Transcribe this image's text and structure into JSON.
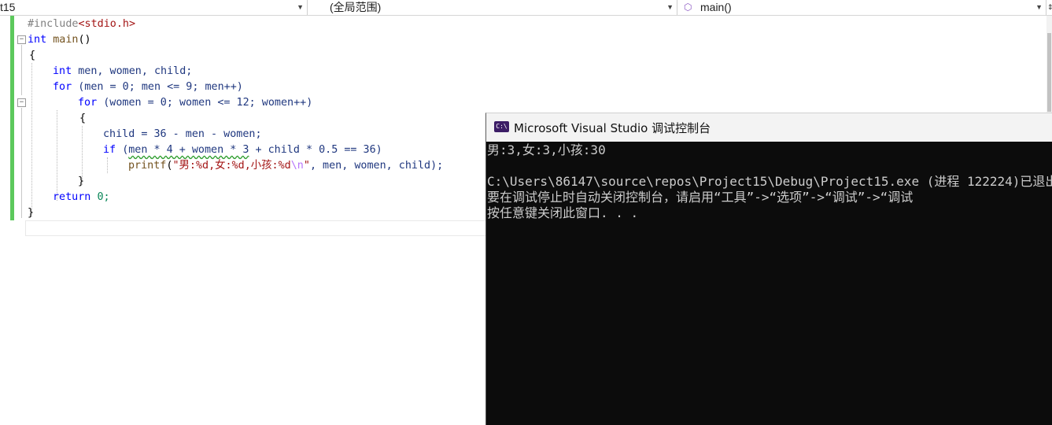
{
  "navbar": {
    "project_combo": "t15",
    "scope_combo": "(全局范围)",
    "function_combo": "main()"
  },
  "editor": {
    "lines": [
      {
        "kind": "include",
        "directive": "#include",
        "header": "<stdio.h>"
      },
      {
        "kind": "text",
        "kw": "int",
        "rest_fn": "main",
        "rest": "()"
      },
      {
        "kind": "text",
        "text": "{"
      },
      {
        "kind": "decl",
        "kw": "int",
        "text": "men, women, child;"
      },
      {
        "kind": "for1",
        "kw": "for",
        "text": "(men = 0; men <= 9; men++)"
      },
      {
        "kind": "for2",
        "kw": "for",
        "text": "(women = 0; women <= 12; women++)"
      },
      {
        "kind": "text",
        "text": "{"
      },
      {
        "kind": "assign",
        "text": "child = 36 - men - women;"
      },
      {
        "kind": "if",
        "kw": "if",
        "squiggle": "men * 4 + women * 3",
        "text_pre": "(",
        "text_post": " + child * 0.5 == 36)"
      },
      {
        "kind": "printf",
        "fn": "printf",
        "str": "\"男:%d,女:%d,小孩:%d",
        "esc": "\\n",
        "str_end": "\"",
        "args": ", men, women, child);"
      },
      {
        "kind": "text",
        "text": "}"
      },
      {
        "kind": "return",
        "kw": "return",
        "text": "0;"
      },
      {
        "kind": "text",
        "text": "}"
      }
    ]
  },
  "console": {
    "title": "Microsoft Visual Studio 调试控制台",
    "icon_label": "C:\\",
    "output": [
      "男:3,女:3,小孩:30",
      "",
      "C:\\Users\\86147\\source\\repos\\Project15\\Debug\\Project15.exe (进程 122224)已退出",
      "要在调试停止时自动关闭控制台，请启用“工具”->“选项”->“调试”->“调试",
      "按任意键关闭此窗口. . ."
    ]
  },
  "colors": {
    "keyword": "#0000ff",
    "identifier": "#1f377f",
    "function": "#74531f",
    "string": "#a31515",
    "change_bar": "#5cc95c",
    "console_bg": "#0c0c0c",
    "console_text": "#cccccc"
  }
}
